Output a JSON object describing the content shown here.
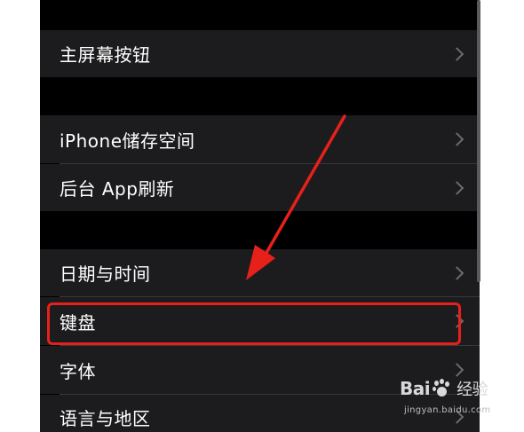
{
  "settings": {
    "group1": {
      "items": [
        {
          "label": "主屏幕按钮"
        }
      ]
    },
    "group2": {
      "items": [
        {
          "label": "iPhone储存空间"
        },
        {
          "label": "后台 App刷新"
        }
      ]
    },
    "group3": {
      "items": [
        {
          "label": "日期与时间"
        },
        {
          "label": "键盘",
          "highlighted": true
        },
        {
          "label": "字体"
        },
        {
          "label": "语言与地区"
        }
      ]
    }
  },
  "annotation": {
    "arrow_color": "#e8201a",
    "highlight_color": "#e8201a"
  },
  "watermark": {
    "logo_text_left": "Bai",
    "logo_text_right": "经验",
    "url": "jingyan.baidu.com"
  },
  "colors": {
    "row_background": "#1c1c1e",
    "page_background": "#000000",
    "text": "#ffffff",
    "chevron": "#6b6b70"
  }
}
